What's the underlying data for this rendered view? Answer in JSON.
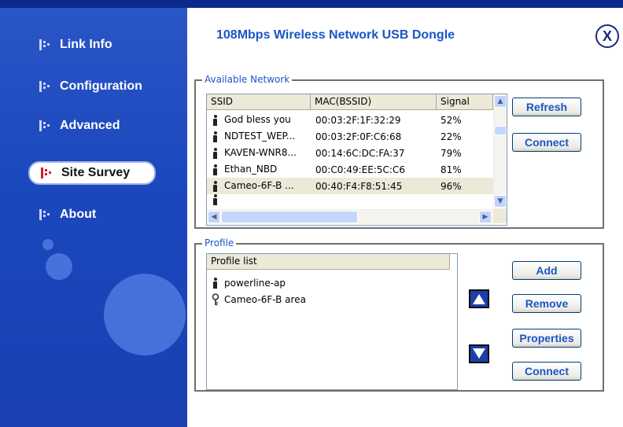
{
  "app": {
    "title": "108Mbps Wireless Network USB Dongle",
    "close_label": "X"
  },
  "sidebar": {
    "items": [
      {
        "label": "Link Info",
        "active": false
      },
      {
        "label": "Configuration",
        "active": false
      },
      {
        "label": "Advanced",
        "active": false
      },
      {
        "label": "Site Survey",
        "active": true
      },
      {
        "label": "About",
        "active": false
      }
    ]
  },
  "available_network": {
    "legend": "Available Network",
    "columns": [
      "SSID",
      "MAC(BSSID)",
      "Signal"
    ],
    "rows": [
      {
        "ssid": "God bless you",
        "mac": "00:03:2F:1F:32:29",
        "signal": "52%"
      },
      {
        "ssid": "NDTEST_WEP...",
        "mac": "00:03:2F:0F:C6:68",
        "signal": "22%"
      },
      {
        "ssid": "KAVEN-WNR8...",
        "mac": "00:14:6C:DC:FA:37",
        "signal": "79%"
      },
      {
        "ssid": "Ethan_NBD",
        "mac": "00:C0:49:EE:5C:C6",
        "signal": "81%"
      },
      {
        "ssid": "Cameo-6F-B ...",
        "mac": "00:40:F4:F8:51:45",
        "signal": "96%"
      }
    ],
    "buttons": {
      "refresh": "Refresh",
      "connect": "Connect"
    }
  },
  "profile": {
    "legend": "Profile",
    "column": "Profile list",
    "items": [
      {
        "name": "powerline-ap",
        "icon": "person-icon"
      },
      {
        "name": "Cameo-6F-B area",
        "icon": "key-icon"
      }
    ],
    "buttons": {
      "add": "Add",
      "remove": "Remove",
      "properties": "Properties",
      "connect": "Connect"
    }
  },
  "colors": {
    "sidebar": "#1d49bd",
    "accent": "#1b55c7",
    "header_band": "#0b2a8c"
  }
}
